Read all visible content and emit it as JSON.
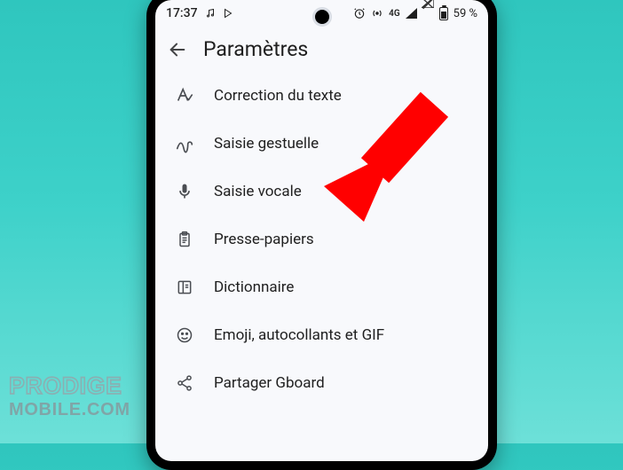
{
  "status": {
    "time": "17:37",
    "network_label": "4G",
    "battery_percent": "59 %"
  },
  "header": {
    "title": "Paramètres"
  },
  "menu": {
    "items": [
      {
        "label": "Correction du texte",
        "icon": "text-correction-icon"
      },
      {
        "label": "Saisie gestuelle",
        "icon": "gesture-icon"
      },
      {
        "label": "Saisie vocale",
        "icon": "mic-icon"
      },
      {
        "label": "Presse-papiers",
        "icon": "clipboard-icon"
      },
      {
        "label": "Dictionnaire",
        "icon": "dictionary-icon"
      },
      {
        "label": "Emoji, autocollants et GIF",
        "icon": "emoji-icon"
      },
      {
        "label": "Partager Gboard",
        "icon": "share-icon"
      }
    ]
  },
  "annotation": {
    "arrow_target": "Saisie vocale"
  },
  "watermark": {
    "line1": "PRODIGE",
    "line2": "MOBILE.COM"
  }
}
